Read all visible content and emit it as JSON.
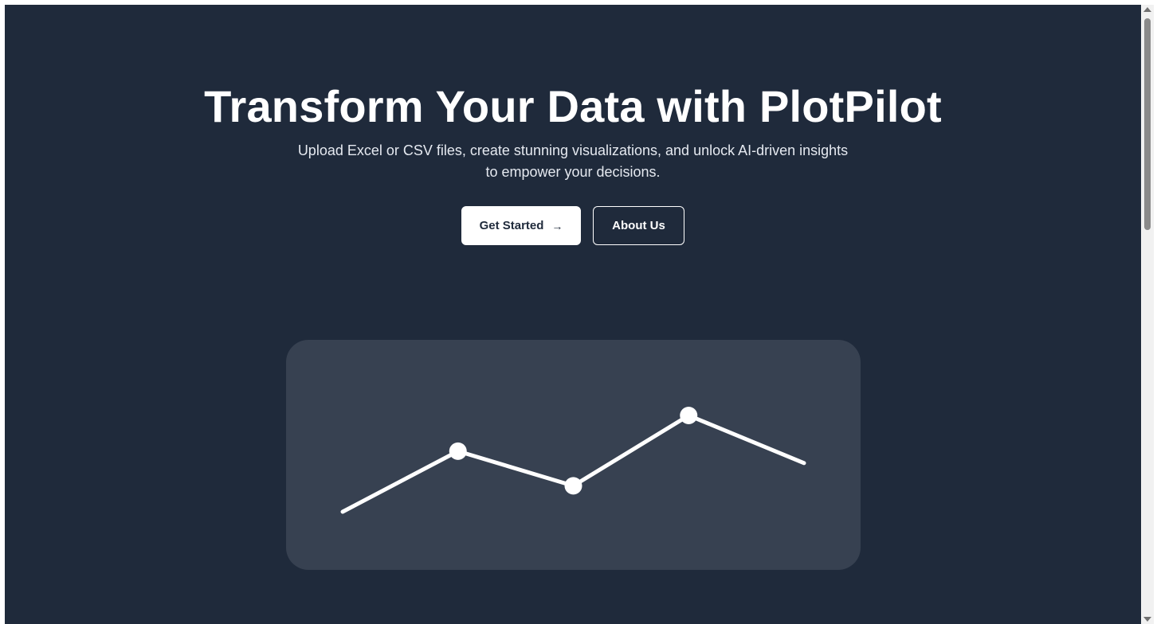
{
  "hero": {
    "title": "Transform Your Data with PlotPilot",
    "subtitle_line1": "Upload Excel or CSV files, create stunning visualizations, and unlock AI-driven insights",
    "subtitle_line2": "to empower your decisions."
  },
  "actions": {
    "get_started_label": "Get Started",
    "get_started_icon": "arrow-right-icon",
    "get_started_glyph": "→",
    "about_label": "About Us"
  },
  "colors": {
    "background": "#1f2a3b",
    "card": "#374151",
    "accent": "#ffffff"
  },
  "chart_data": {
    "type": "line",
    "x": [
      0,
      1,
      2,
      3,
      4
    ],
    "values": [
      0,
      56,
      24,
      89,
      45
    ],
    "ylim": [
      0,
      100
    ],
    "markers_on": [
      1,
      2,
      3
    ]
  }
}
